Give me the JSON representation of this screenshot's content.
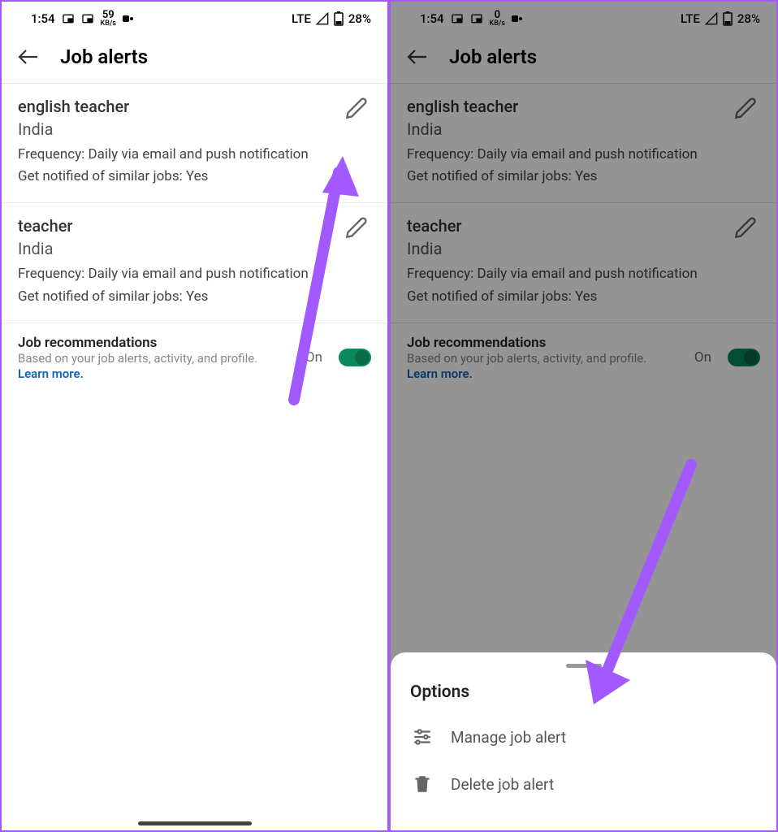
{
  "status": {
    "time": "1:54",
    "net1": "59",
    "net2": "0",
    "netUnit": "KB/s",
    "signal": "LTE",
    "battery": "28%"
  },
  "header": {
    "title": "Job alerts"
  },
  "alerts": [
    {
      "title": "english teacher",
      "location": "India",
      "frequency": "Frequency: Daily via email and push notification",
      "similar": "Get notified of similar jobs: Yes"
    },
    {
      "title": "teacher",
      "location": "India",
      "frequency": "Frequency: Daily via email and push notification",
      "similar": "Get notified of similar jobs: Yes"
    }
  ],
  "recs": {
    "title": "Job recommendations",
    "subtitle": "Based on your job alerts, activity, and profile.",
    "link": "Learn more.",
    "state": "On"
  },
  "sheet": {
    "title": "Options",
    "manage": "Manage job alert",
    "delete": "Delete job alert"
  }
}
